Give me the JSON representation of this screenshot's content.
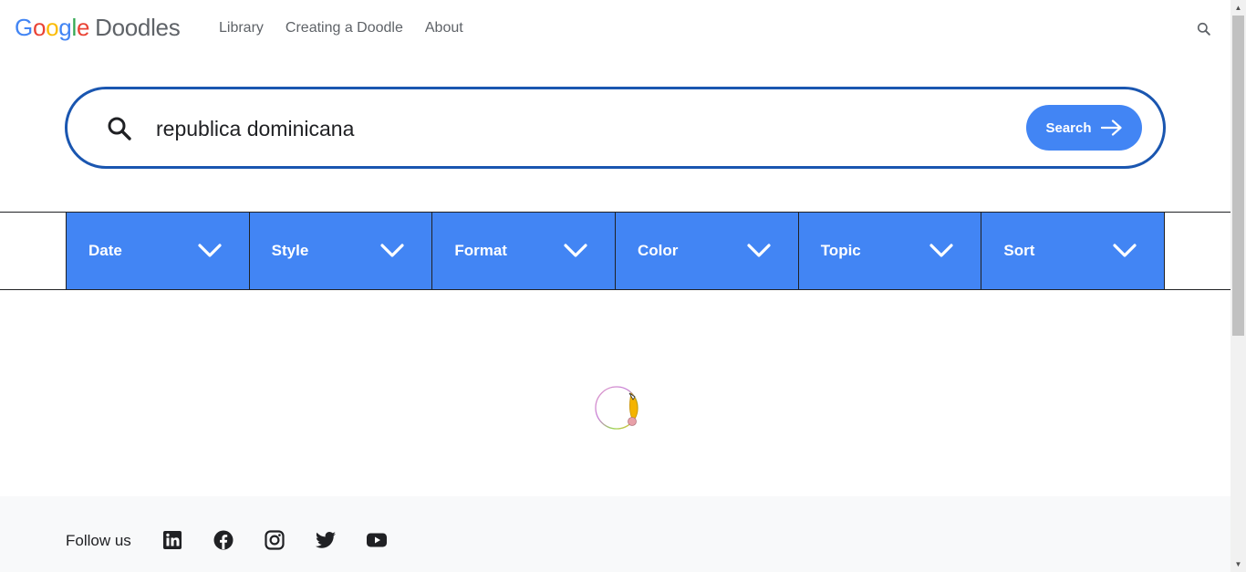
{
  "header": {
    "logo": {
      "g1": "G",
      "o1": "o",
      "o2": "o",
      "g2": "g",
      "l": "l",
      "e": "e",
      "doodles": "Doodles"
    },
    "nav": [
      {
        "label": "Library"
      },
      {
        "label": "Creating a Doodle"
      },
      {
        "label": "About"
      }
    ],
    "search_icon": "search-icon"
  },
  "search": {
    "value": "republica dominicana",
    "button_label": "Search",
    "accent": "#4285f4",
    "border_color": "#1a56b0"
  },
  "filters": [
    {
      "label": "Date"
    },
    {
      "label": "Style"
    },
    {
      "label": "Format"
    },
    {
      "label": "Color"
    },
    {
      "label": "Topic"
    },
    {
      "label": "Sort"
    }
  ],
  "footer": {
    "follow_label": "Follow us",
    "social": [
      "linkedin-icon",
      "facebook-icon",
      "instagram-icon",
      "twitter-icon",
      "youtube-icon"
    ]
  }
}
